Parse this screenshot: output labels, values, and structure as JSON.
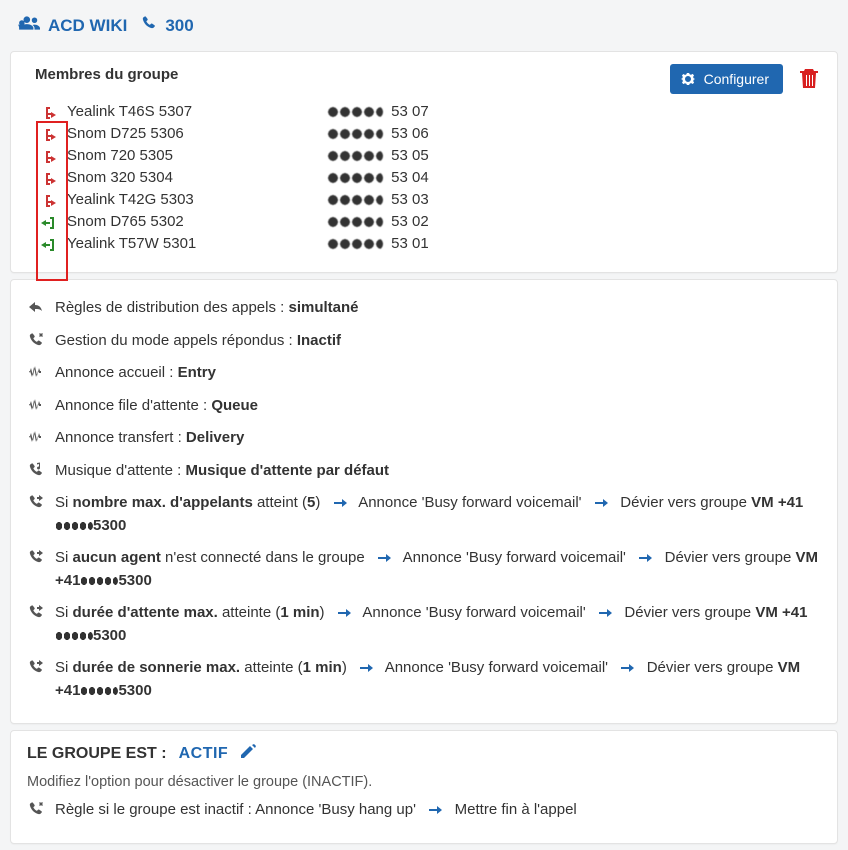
{
  "header": {
    "title": "ACD WIKI",
    "extension": "300"
  },
  "members": {
    "title": "Membres du groupe",
    "configure_label": "Configurer",
    "rows": [
      {
        "status": "out",
        "name": "Yealink T46S 5307",
        "ext": "53 07"
      },
      {
        "status": "out",
        "name": "Snom D725 5306",
        "ext": "53 06"
      },
      {
        "status": "out",
        "name": "Snom 720 5305",
        "ext": "53 05"
      },
      {
        "status": "out",
        "name": "Snom 320 5304",
        "ext": "53 04"
      },
      {
        "status": "out",
        "name": "Yealink T42G 5303",
        "ext": "53 03"
      },
      {
        "status": "in",
        "name": "Snom D765 5302",
        "ext": "53 02"
      },
      {
        "status": "in",
        "name": "Yealink T57W 5301",
        "ext": "53 01"
      }
    ]
  },
  "rules": {
    "distribution_label": "Règles de distribution des appels : ",
    "distribution_value": "simultané",
    "answered_label": "Gestion du mode appels répondus : ",
    "answered_value": "Inactif",
    "welcome_label": "Annonce accueil : ",
    "welcome_value": "Entry",
    "queue_label": "Annonce file d'attente : ",
    "queue_value": "Queue",
    "transfer_label": "Annonce transfert : ",
    "transfer_value": "Delivery",
    "hold_label": "Musique d'attente : ",
    "hold_value": "Musique d'attente par défaut",
    "overflow": {
      "max_callers_prefix": "Si ",
      "max_callers_b1": "nombre max. d'appelants",
      "max_callers_mid": " atteint (",
      "max_callers_count": "5",
      "max_callers_end": ")",
      "no_agent_prefix": "Si ",
      "no_agent_b1": "aucun agent",
      "no_agent_mid": " n'est connecté dans le groupe",
      "wait_prefix": "Si ",
      "wait_b1": "durée d'attente max.",
      "wait_mid": " atteinte (",
      "wait_val": "1 min",
      "wait_end": ")",
      "ring_prefix": "Si ",
      "ring_b1": "durée de sonnerie max.",
      "ring_mid": " atteinte (",
      "ring_val": "1 min",
      "ring_end": ")",
      "announce": "Annonce 'Busy forward voicemail'",
      "divert_prefix": "Dévier vers groupe ",
      "divert_group": "VM",
      "divert_num_prefix": "+41",
      "divert_num_suffix": "5300"
    }
  },
  "status": {
    "label": "LE GROUPE EST :",
    "value": "ACTIF",
    "hint": "Modifiez l'option pour désactiver le groupe (INACTIF).",
    "inactive_rule_prefix": "Règle si le groupe est inactif : Annonce 'Busy hang up'",
    "inactive_rule_action": "Mettre fin à l'appel"
  }
}
